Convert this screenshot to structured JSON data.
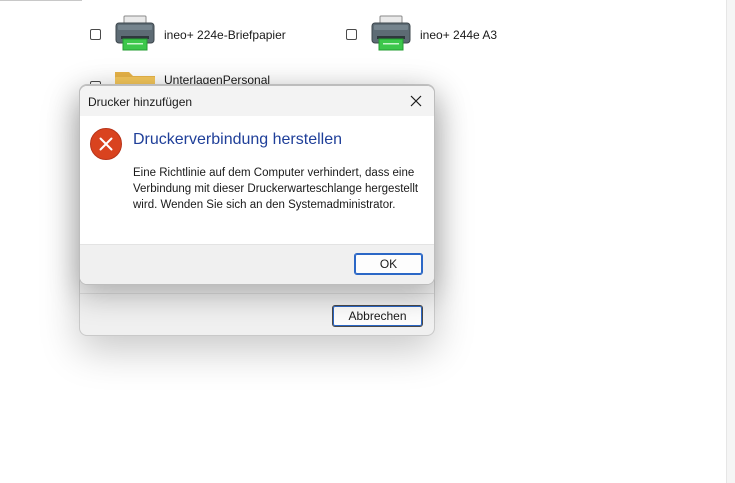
{
  "printers": [
    {
      "label": "ineo+ 224e-Briefpapier",
      "icon": "printer-icon"
    },
    {
      "label": "ineo+ 244e A3",
      "icon": "printer-icon"
    },
    {
      "label": "UnterlagenPersonal",
      "icon": "folder-icon"
    }
  ],
  "background_dialog": {
    "cancel_label": "Abbrechen"
  },
  "dialog": {
    "title": "Drucker hinzufügen",
    "heading": "Druckerverbindung herstellen",
    "message": "Eine Richtlinie auf dem Computer verhindert, dass eine Verbindung mit dieser Druckerwarteschlange hergestellt wird. Wenden Sie sich an den Systemadministrator.",
    "ok_label": "OK",
    "icon": "error-icon",
    "close_icon": "close-icon"
  },
  "colors": {
    "heading": "#1f3f99",
    "error_red": "#d9431f",
    "accent_blue": "#2b67c6",
    "printer_green": "#3cc74b"
  }
}
